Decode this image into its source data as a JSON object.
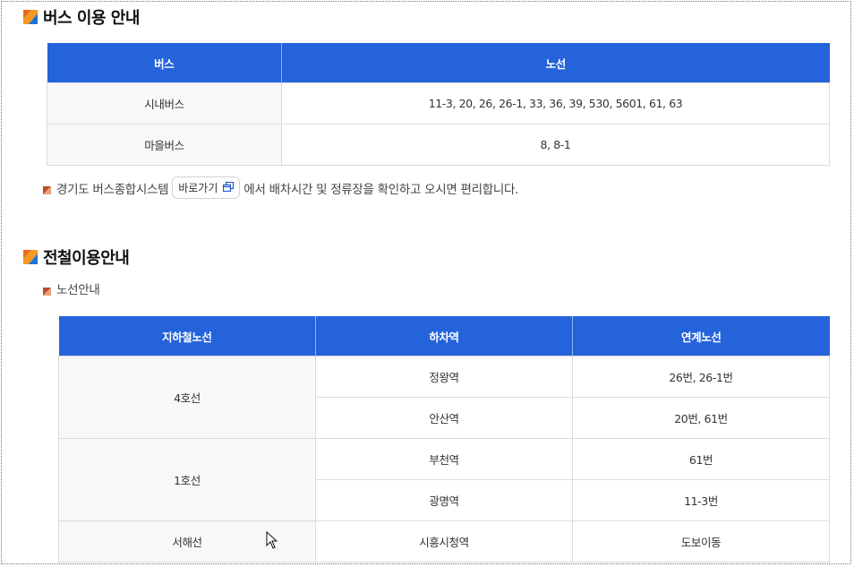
{
  "bus_section": {
    "title": "버스 이용 안내",
    "headers": [
      "버스",
      "노선"
    ],
    "rows": [
      {
        "type": "시내버스",
        "routes": "11-3, 20, 26, 26-1, 33, 36, 39, 530, 5601, 61, 63"
      },
      {
        "type": "마을버스",
        "routes": "8, 8-1"
      }
    ],
    "note_before": "경기도 버스종합시스템",
    "link_label": "바로가기",
    "note_after": "에서 배차시간 및 정류장을 확인하고 오시면 편리합니다."
  },
  "subway_section": {
    "title": "전철이용안내",
    "subtitle": "노선안내",
    "headers": [
      "지하철노선",
      "하차역",
      "연계노선"
    ],
    "groups": [
      {
        "line": "4호선",
        "stops": [
          {
            "station": "정왕역",
            "connection": "26번, 26-1번"
          },
          {
            "station": "안산역",
            "connection": "20번, 61번"
          }
        ]
      },
      {
        "line": "1호선",
        "stops": [
          {
            "station": "부천역",
            "connection": "61번"
          },
          {
            "station": "광명역",
            "connection": "11-3번"
          }
        ]
      },
      {
        "line": "서해선",
        "stops": [
          {
            "station": "시흥시청역",
            "connection": "도보이동"
          }
        ]
      }
    ]
  },
  "colors": {
    "header_blue": "#2563db",
    "icon_orange": "#f26522",
    "icon_blue": "#1e73d8",
    "bullet_brown": "#b5502a"
  }
}
